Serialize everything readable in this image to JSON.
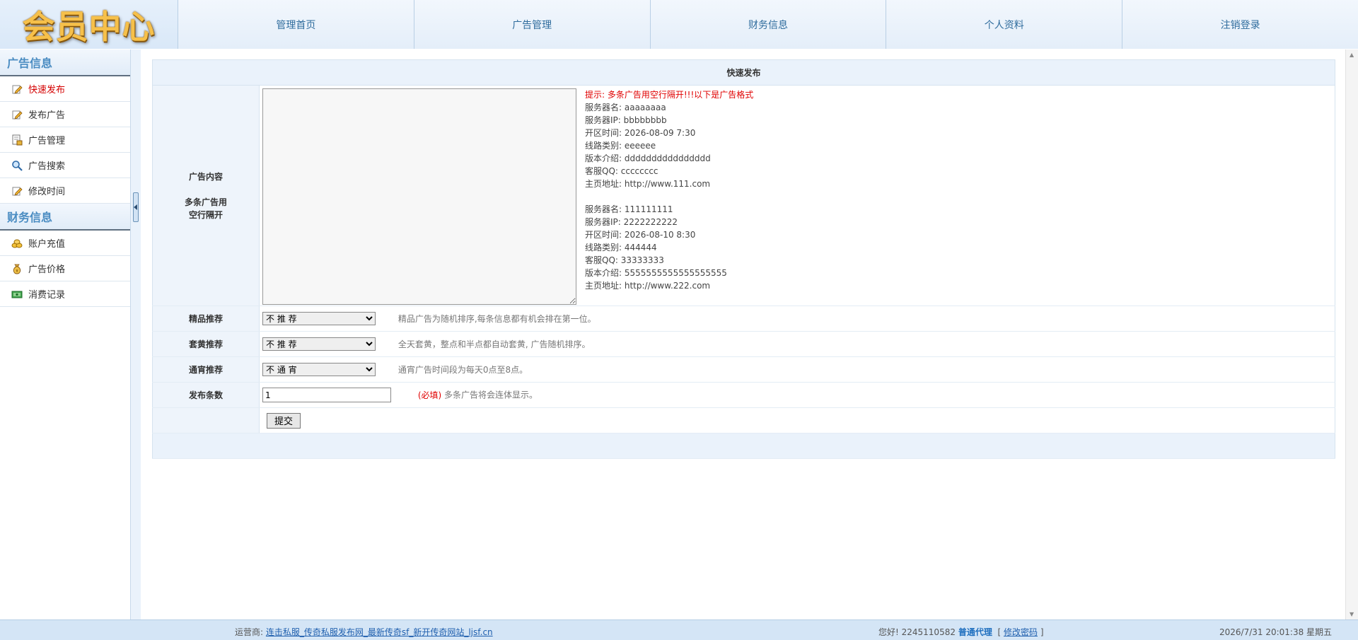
{
  "header": {
    "logo_text": "会员中心",
    "nav": [
      "管理首页",
      "广告管理",
      "财务信息",
      "个人资料",
      "注销登录"
    ]
  },
  "sidebar": {
    "sections": [
      {
        "title": "广告信息",
        "items": [
          {
            "label": "快速发布",
            "icon": "edit-icon",
            "active": true
          },
          {
            "label": "发布广告",
            "icon": "edit-icon"
          },
          {
            "label": "广告管理",
            "icon": "document-lock-icon"
          },
          {
            "label": "广告搜索",
            "icon": "search-icon"
          },
          {
            "label": "修改时间",
            "icon": "edit-icon"
          }
        ]
      },
      {
        "title": "财务信息",
        "items": [
          {
            "label": "账户充值",
            "icon": "coins-icon"
          },
          {
            "label": "广告价格",
            "icon": "money-bag-icon"
          },
          {
            "label": "消费记录",
            "icon": "cash-icon"
          }
        ]
      }
    ]
  },
  "form": {
    "title": "快速发布",
    "ad_content": {
      "label_line1": "广告内容",
      "label_line2": "多条广告用",
      "label_line3": "空行隔开",
      "value": ""
    },
    "hint": {
      "warning": "提示: 多条广告用空行隔开!!!以下是广告格式",
      "example1": [
        "服务器名: aaaaaaaa",
        "服务器IP: bbbbbbbb",
        "开区时间: 2026-08-09 7:30",
        "线路类别: eeeeee",
        "版本介绍: dddddddddddddddd",
        "客服QQ: cccccccc",
        "主页地址: http://www.111.com"
      ],
      "example2": [
        "服务器名: 111111111",
        "服务器IP: 2222222222",
        "开区时间: 2026-08-10 8:30",
        "线路类别: 444444",
        "客服QQ: 33333333",
        "版本介绍: 5555555555555555555",
        "主页地址: http://www.222.com"
      ]
    },
    "featured": {
      "label": "精品推荐",
      "selected": "不 推 荐",
      "desc": "精品广告为随机排序,每条信息都有机会排在第一位。"
    },
    "yellow": {
      "label": "套黄推荐",
      "selected": "不 推 荐",
      "desc": "全天套黄，整点和半点都自动套黄, 广告随机排序。"
    },
    "overnight": {
      "label": "通宵推荐",
      "selected": "不 通 宵",
      "desc": "通宵广告时间段为每天0点至8点。"
    },
    "count": {
      "label": "发布条数",
      "value": "1",
      "required": "(必填)",
      "desc": "多条广告将会连体显示。"
    },
    "submit_label": "提交"
  },
  "statusbar": {
    "operator_label": "运营商:",
    "operator_link": "连击私服_传奇私服发布网_最新传奇sf_新开传奇网站_ljsf.cn",
    "greeting": "您好! 2245110582",
    "role": "普通代理",
    "change_pwd_open": "[",
    "change_pwd": "修改密码",
    "change_pwd_close": "]",
    "datetime": "2026/7/31 20:01:38 星期五"
  },
  "colors": {
    "nav_text": "#2f6c9d",
    "section_title": "#4a8cc2",
    "active_item": "#d40000",
    "hint_red": "#e00000",
    "header_bg": "#eaf2fb"
  }
}
